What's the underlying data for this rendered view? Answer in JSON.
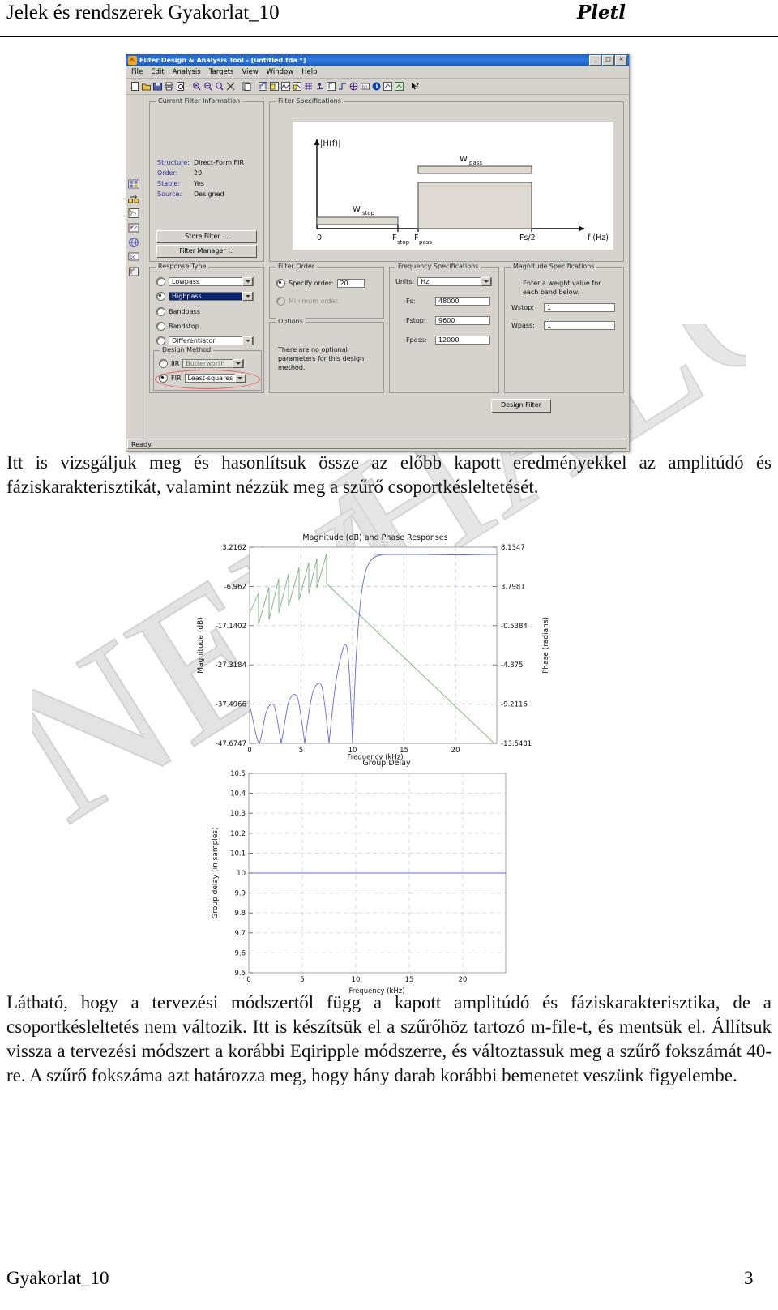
{
  "header": {
    "title": "Jelek és rendszerek Gyakorlat_10",
    "author": "Pletl"
  },
  "footer": {
    "left": "Gyakorlat_10",
    "page": "3"
  },
  "fda_window": {
    "title": "Filter Design & Analysis Tool - [untitled.fda *]",
    "icon": "matlab-icon",
    "window_buttons": {
      "minimize": "_",
      "maximize": "□",
      "close": "✕"
    },
    "menus": [
      "File",
      "Edit",
      "Analysis",
      "Targets",
      "View",
      "Window",
      "Help"
    ],
    "toolbar_icons": [
      "new-file-icon",
      "open-folder-icon",
      "save-icon",
      "print-icon",
      "print-preview-icon",
      "zoom-in-icon",
      "zoom-out-icon",
      "zoom-fit-icon",
      "zoom-reset-icon",
      "copy-icon",
      "filter-spec-icon",
      "magnitude-response-icon",
      "phase-response-icon",
      "mag-phase-icon",
      "group-delay-icon",
      "phase-delay-icon",
      "impulse-response-icon",
      "step-response-icon",
      "pole-zero-icon",
      "filter-coefficients-icon",
      "filter-information-icon",
      "magnitude-estimate-icon",
      "round-off-noise-icon",
      "help-pointer-icon"
    ],
    "side_icons": [
      "design-filter-side-icon",
      "import-filter-side-icon",
      "quantize-filter-side-icon",
      "transform-filter-side-icon",
      "multirate-filter-side-icon",
      "realize-model-side-icon",
      "set-quantization-side-icon"
    ],
    "status": "Ready",
    "current_filter_information": {
      "legend": "Current Filter Information",
      "rows": [
        {
          "label": "Structure:",
          "value": "Direct-Form FIR"
        },
        {
          "label": "Order:",
          "value": "20"
        },
        {
          "label": "Stable:",
          "value": "Yes"
        },
        {
          "label": "Source:",
          "value": "Designed"
        }
      ],
      "store_filter_button": "Store Filter ...",
      "filter_manager_button": "Filter Manager ..."
    },
    "filter_specifications": {
      "legend": "Filter Specifications",
      "y_label": "|H(f)|",
      "x_label": "f (Hz)",
      "ticks": [
        "0",
        "F",
        "stop",
        "F",
        "pass",
        "Fs/2"
      ],
      "tick_fstop": "F",
      "tick_fstop_sub": "stop",
      "tick_fpass": "F",
      "tick_fpass_sub": "pass",
      "tick_zero": "0",
      "tick_fs2": "Fs/2",
      "band_wstop": "W",
      "band_wstop_sub": "stop",
      "band_wpass": "W",
      "band_wpass_sub": "pass"
    },
    "response_type": {
      "legend": "Response Type",
      "options": [
        {
          "label": "Lowpass",
          "type": "combo",
          "selected": false,
          "highlighted": false
        },
        {
          "label": "Highpass",
          "type": "combo",
          "selected": true,
          "highlighted": true
        },
        {
          "label": "Bandpass",
          "type": "radio",
          "selected": false
        },
        {
          "label": "Bandstop",
          "type": "radio",
          "selected": false
        },
        {
          "label": "Differentiator",
          "type": "combo",
          "selected": false,
          "highlighted": false
        }
      ]
    },
    "design_method": {
      "legend": "Design Method",
      "iir": {
        "label": "IIR",
        "value": "Butterworth",
        "selected": false
      },
      "fir": {
        "label": "FIR",
        "value": "Least-squares",
        "selected": true,
        "annotated": true
      }
    },
    "filter_order": {
      "legend": "Filter Order",
      "specify_order_label": "Specify order:",
      "specify_order_value": "20",
      "specify_order_selected": true,
      "minimum_order_label": "Minimum order",
      "minimum_order_selected": false,
      "minimum_order_disabled": true
    },
    "options": {
      "legend": "Options",
      "text": "There are no optional parameters for this design method."
    },
    "frequency_specifications": {
      "legend": "Frequency Specifications",
      "units_label": "Units:",
      "units_value": "Hz",
      "fields": [
        {
          "label": "Fs:",
          "value": "48000"
        },
        {
          "label": "Fstop:",
          "value": "9600"
        },
        {
          "label": "Fpass:",
          "value": "12000"
        }
      ]
    },
    "magnitude_specifications": {
      "legend": "Magnitude Specifications",
      "hint": "Enter a weight value for each band below.",
      "fields": [
        {
          "label": "Wstop:",
          "value": "1"
        },
        {
          "label": "Wpass:",
          "value": "1"
        }
      ]
    },
    "design_filter_button": "Design Filter"
  },
  "paragraphs": {
    "p1": "Itt is vizsgáljuk meg és hasonlítsuk össze az előbb kapott eredményekkel az amplitúdó és fáziskarakterisztikát, valamint nézzük meg a szűrő csoportkésleltetését.",
    "p2": "Látható, hogy a tervezési módszertől függ a kapott amplitúdó és fáziskarakterisztika, de a csoportkésleltetés nem változik. Itt is készítsük el a szűrőhöz tartozó m-file-t, és mentsük el. Állítsuk vissza a tervezési módszert a korábbi Eqiripple módszerre, és változtassuk meg a szűrő fokszámát 40-re. A szűrő fokszáma azt határozza meg, hogy hány darab korábbi bemenetet veszünk figyelembe."
  },
  "watermark": {
    "text": "NEM VÁLTO"
  },
  "chart_data": [
    {
      "type": "line",
      "title": "Magnitude (dB) and Phase Responses",
      "xlabel": "Frequency (kHz)",
      "ylabel": "Magnitude (dB)",
      "y2label": "Phase (radians)",
      "xlim": [
        0,
        24
      ],
      "xticks": [
        0,
        5,
        10,
        15,
        20
      ],
      "xticklabels": [
        "0",
        "5",
        "10",
        "15",
        "20"
      ],
      "ylim": [
        -47.6747,
        3.2162
      ],
      "yticks": [
        3.2162,
        -6.962,
        -17.1402,
        -27.3184,
        -37.4966,
        -47.6747
      ],
      "yticklabels": [
        "3.2162",
        "-6.962",
        "-17.1402",
        "-27.3184",
        "-37.4966",
        "-47.6747"
      ],
      "y2lim": [
        -13.5481,
        8.1347
      ],
      "y2ticks": [
        8.1347,
        3.7981,
        -0.5384,
        -4.875,
        -9.2116,
        -13.5481
      ],
      "y2ticklabels": [
        "8.1347",
        "3.7981",
        "-0.5384",
        "-4.875",
        "-9.2116",
        "-13.5481"
      ],
      "grid": true,
      "legend": "none",
      "series": [
        {
          "name": "Magnitude (dB)",
          "color": "#6a6ac8",
          "axis": "left",
          "description": "Highpass magnitude response: stopband ripple lobes below -27 dB for 0-9.6 kHz, sharp transition 9.6-12 kHz, flat passband near 0 dB above 13 kHz"
        },
        {
          "name": "Phase (radians)",
          "color": "#7fae7f",
          "axis": "right",
          "description": "Wrapped linear phase: sawtooth wrapping from 0 to ~9 kHz, then continuous linear decline to -13.5 rad at 24 kHz"
        }
      ]
    },
    {
      "type": "line",
      "title": "Group Delay",
      "xlabel": "Frequency (kHz)",
      "ylabel": "Group delay (in samples)",
      "xlim": [
        0,
        24
      ],
      "xticks": [
        0,
        5,
        10,
        15,
        20
      ],
      "xticklabels": [
        "0",
        "5",
        "10",
        "15",
        "20"
      ],
      "ylim": [
        9.5,
        10.5
      ],
      "yticks": [
        10.5,
        10.4,
        10.3,
        10.2,
        10.1,
        10,
        9.9,
        9.8,
        9.7,
        9.6,
        9.5
      ],
      "yticklabels": [
        "10.5",
        "10.4",
        "10.3",
        "10.2",
        "10.1",
        "10",
        "9.9",
        "9.8",
        "9.7",
        "9.6",
        "9.5"
      ],
      "grid": true,
      "legend": "none",
      "series": [
        {
          "name": "Group delay",
          "color": "#6a6ac8",
          "constant_value": 10,
          "description": "Constant group delay of 10 samples across all frequencies"
        }
      ]
    }
  ]
}
